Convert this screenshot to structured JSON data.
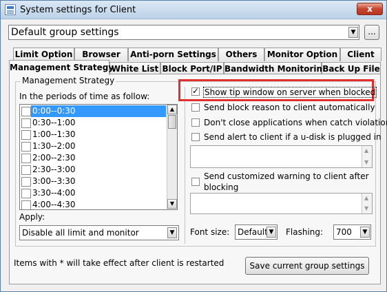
{
  "window": {
    "title": "System settings for Client",
    "close_glyph": "x"
  },
  "group_select": {
    "value": "Default group settings",
    "browse_label": "..."
  },
  "tabs_row1": [
    "Limit Option",
    "Browser",
    "Anti-porn Settings",
    "Others",
    "Monitor Option",
    "Client"
  ],
  "tabs_row2": [
    "Management Strategy",
    "White List",
    "Block Port/IP",
    "Bandwidth Monitoring",
    "Back Up File"
  ],
  "active_tab": "Management Strategy",
  "strategy": {
    "group_title": "Management Strategy",
    "periods_label": "In the periods of time as follow:",
    "periods": [
      "0:00--0:30",
      "0:30--1:00",
      "1:00--1:30",
      "1:30--2:00",
      "2:00--2:30",
      "2:30--3:00",
      "3:00--3:30",
      "3:30--4:00",
      "4:00--4:30"
    ],
    "selected_period": "0:00--0:30",
    "apply_label": "Apply:",
    "apply_value": "Disable all limit and monitor"
  },
  "options": {
    "show_tip": {
      "label": "Show tip window on server when blocked",
      "checked": true
    },
    "send_block_reason": {
      "label": "Send block reason to client automatically",
      "checked": false
    },
    "dont_close": {
      "label": "Don't close applications when catch violation",
      "checked": false
    },
    "send_alert": {
      "label": "Send alert to client if a u-disk is plugged in",
      "checked": false
    },
    "custom_warning_line1": "Send customized warning to client after",
    "custom_warning_line2": "blocking",
    "font_size_label": "Font size:",
    "font_size_value": "Default",
    "flashing_label": "Flashing:",
    "flashing_value": "700"
  },
  "footer": {
    "note": "Items with * will take effect after client is restarted",
    "save_button": "Save current group settings"
  },
  "colors": {
    "highlight": "#e03030",
    "selection": "#3399ff"
  },
  "icons": {
    "dropdown": "chevron-down-icon",
    "scroll_up": "scroll-up-arrow-icon",
    "scroll_down": "scroll-down-arrow-icon",
    "app": "settings-app-icon"
  }
}
